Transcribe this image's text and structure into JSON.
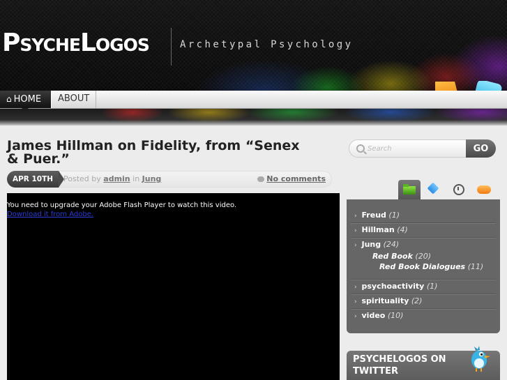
{
  "header": {
    "logo": "PsycheLogos",
    "tagline": "Archetypal Psychology"
  },
  "nav": {
    "items": [
      {
        "label": "HOME",
        "active": true
      },
      {
        "label": "ABOUT",
        "active": false
      }
    ]
  },
  "post": {
    "title": "James Hillman on Fidelity, from “Senex & Puer.”",
    "date": "APR 10TH",
    "posted_by_label": "Posted by",
    "author": "admin",
    "in_label": "in",
    "category": "Jung",
    "comments": "No comments",
    "flash_message": "You need to upgrade your Adobe Flash Player to watch this video.",
    "flash_link": "Download it from Adobe."
  },
  "search": {
    "placeholder": "Search",
    "button_label": "GO"
  },
  "sidebar": {
    "tabs": [
      "folder-icon",
      "tag-icon",
      "clock-icon",
      "speech-bubble-icon"
    ],
    "categories": [
      {
        "name": "Freud",
        "count": "(1)"
      },
      {
        "name": "Hillman",
        "count": "(4)"
      },
      {
        "name": "Jung",
        "count": "(24)",
        "children": [
          {
            "name": "Red Book",
            "count": "(20)",
            "children": [
              {
                "name": "Red Book Dialogues",
                "count": "(11)"
              }
            ]
          }
        ]
      },
      {
        "name": "psychoactivity",
        "count": "(1)"
      },
      {
        "name": "spirituality",
        "count": "(2)"
      },
      {
        "name": "video",
        "count": "(10)"
      }
    ],
    "twitter_title": "PSYCHELOGOS ON TWITTER"
  },
  "colors": {
    "active_nav": "#111111",
    "link_blue": "#2b3bd6",
    "panel_gray": "#666666"
  }
}
